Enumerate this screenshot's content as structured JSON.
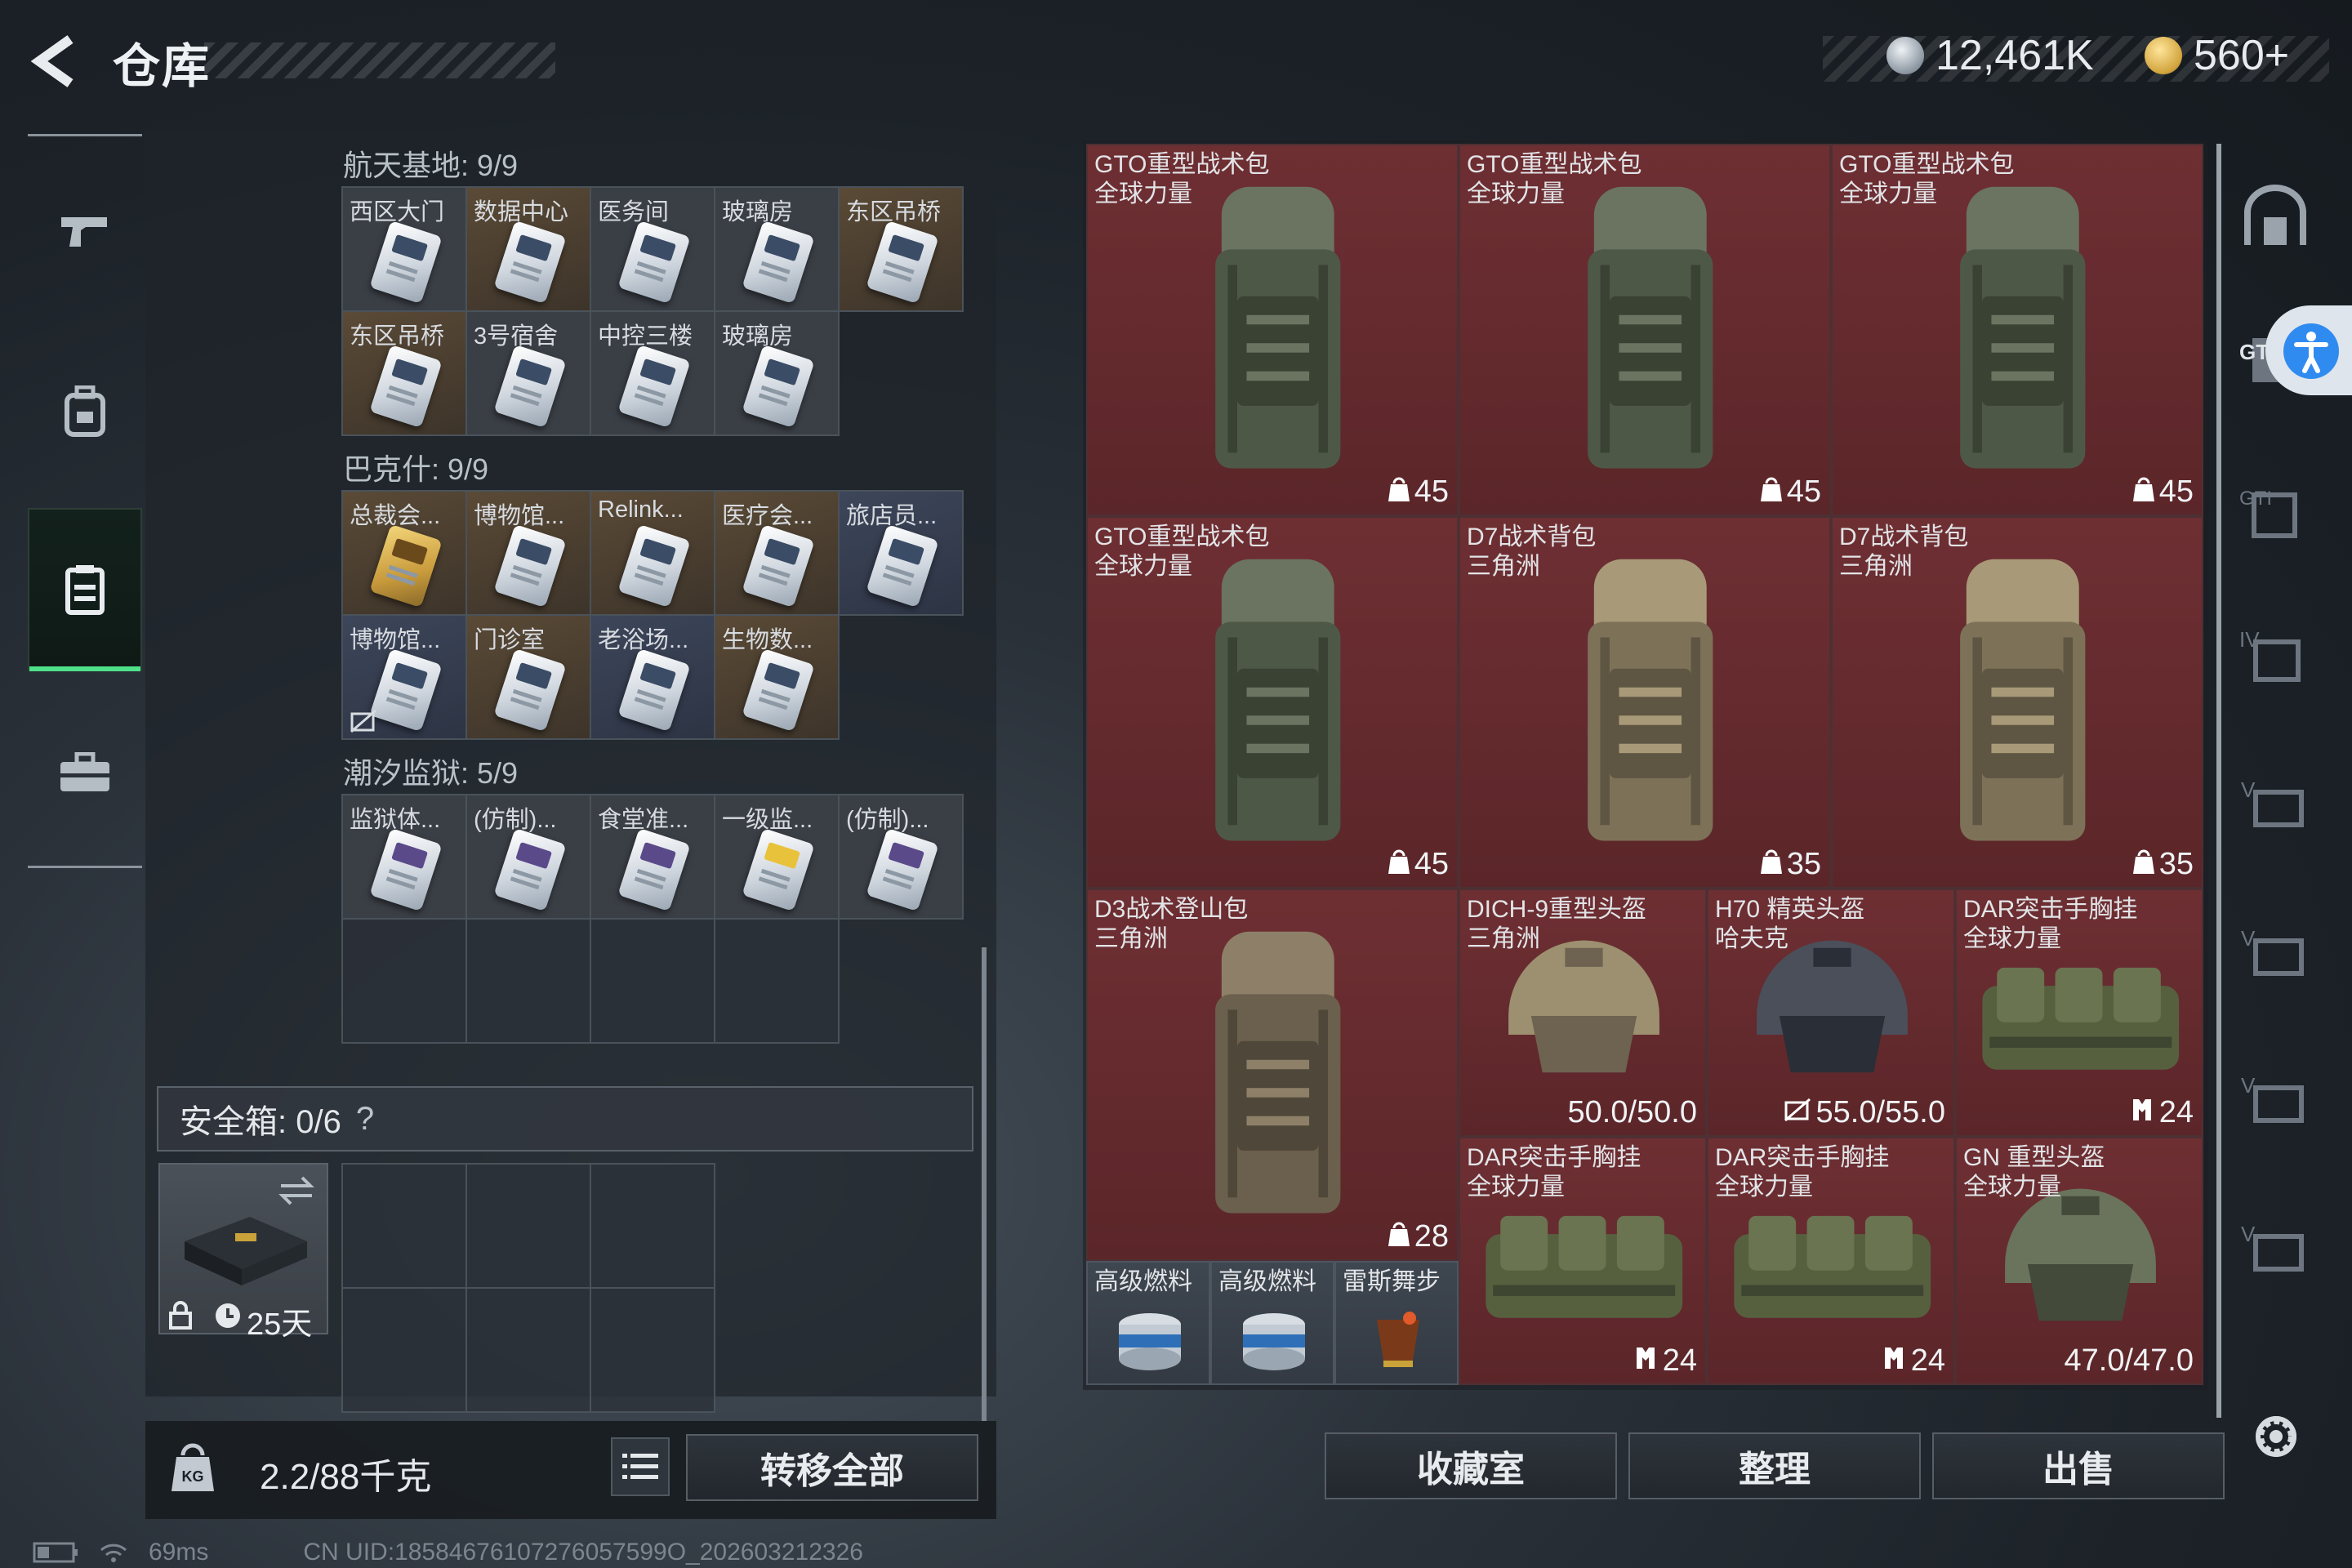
{
  "header": {
    "title": "仓库",
    "currency1": "12,461K",
    "currency2": "560+"
  },
  "nav": [
    {
      "icon": "pistol-icon"
    },
    {
      "icon": "backpack-icon"
    },
    {
      "icon": "storage-icon",
      "active": true
    },
    {
      "icon": "toolbox-icon"
    }
  ],
  "sections": [
    {
      "title": "航天基地: 9/9",
      "cells": [
        {
          "label": "西区大门"
        },
        {
          "label": "数据中心"
        },
        {
          "label": "医务间"
        },
        {
          "label": "玻璃房"
        },
        {
          "label": "东区吊桥"
        },
        {
          "label": "东区吊桥"
        },
        {
          "label": "3号宿舍"
        },
        {
          "label": "中控三楼"
        },
        {
          "label": "玻璃房"
        }
      ]
    },
    {
      "title": "巴克什: 9/9",
      "cells": [
        {
          "label": "总裁会..."
        },
        {
          "label": "博物馆..."
        },
        {
          "label": "Relink..."
        },
        {
          "label": "医疗会..."
        },
        {
          "label": "旅店员..."
        },
        {
          "label": "博物馆..."
        },
        {
          "label": "门诊室"
        },
        {
          "label": "老浴场..."
        },
        {
          "label": "生物数..."
        }
      ]
    },
    {
      "title": "潮汐监狱: 5/9",
      "cells": [
        {
          "label": "监狱体..."
        },
        {
          "label": "(仿制)..."
        },
        {
          "label": "食堂准..."
        },
        {
          "label": "一级监..."
        },
        {
          "label": "(仿制)..."
        }
      ]
    }
  ],
  "safebox": {
    "label": "安全箱: 0/6",
    "help": "?",
    "item_days": "25天"
  },
  "weight": {
    "text": "2.2/88千克"
  },
  "buttons": {
    "transfer_all": "转移全部",
    "collection": "收藏室",
    "organize": "整理",
    "sell": "出售"
  },
  "storage": [
    {
      "name": "GTO重型战术包\n全球力量",
      "value": "45"
    },
    {
      "name": "GTO重型战术包\n全球力量",
      "value": "45"
    },
    {
      "name": "GTO重型战术包\n全球力量",
      "value": "45"
    },
    {
      "name": "GTO重型战术包\n全球力量",
      "value": "45"
    },
    {
      "name": "D7战术背包\n三角洲",
      "value": "35"
    },
    {
      "name": "D7战术背包\n三角洲",
      "value": "35"
    },
    {
      "name": "D3战术登山包\n三角洲",
      "value": "28"
    },
    {
      "name": "DICH-9重型头盔\n三角洲",
      "value": "50.0/50.0"
    },
    {
      "name": "H70 精英头盔\n哈夫克",
      "value": "55.0/55.0"
    },
    {
      "name": "DAR突击手胸挂\n全球力量",
      "value": "24"
    },
    {
      "name": "DAR突击手胸挂\n全球力量",
      "value": "24"
    },
    {
      "name": "DAR突击手胸挂\n全球力量",
      "value": "24"
    },
    {
      "name": "GN 重型头盔\n全球力量",
      "value": "47.0/47.0"
    },
    {
      "name": "高级燃料",
      "value": ""
    },
    {
      "name": "高级燃料",
      "value": ""
    },
    {
      "name": "雷斯舞步",
      "value": ""
    }
  ],
  "status": {
    "ping": "69ms",
    "uid": "CN UID:18584676107276057599O_202603212326"
  },
  "colors": {
    "accent": "#4fe08a",
    "item_bg": "#6e2f33",
    "panel": "#1e242a"
  }
}
